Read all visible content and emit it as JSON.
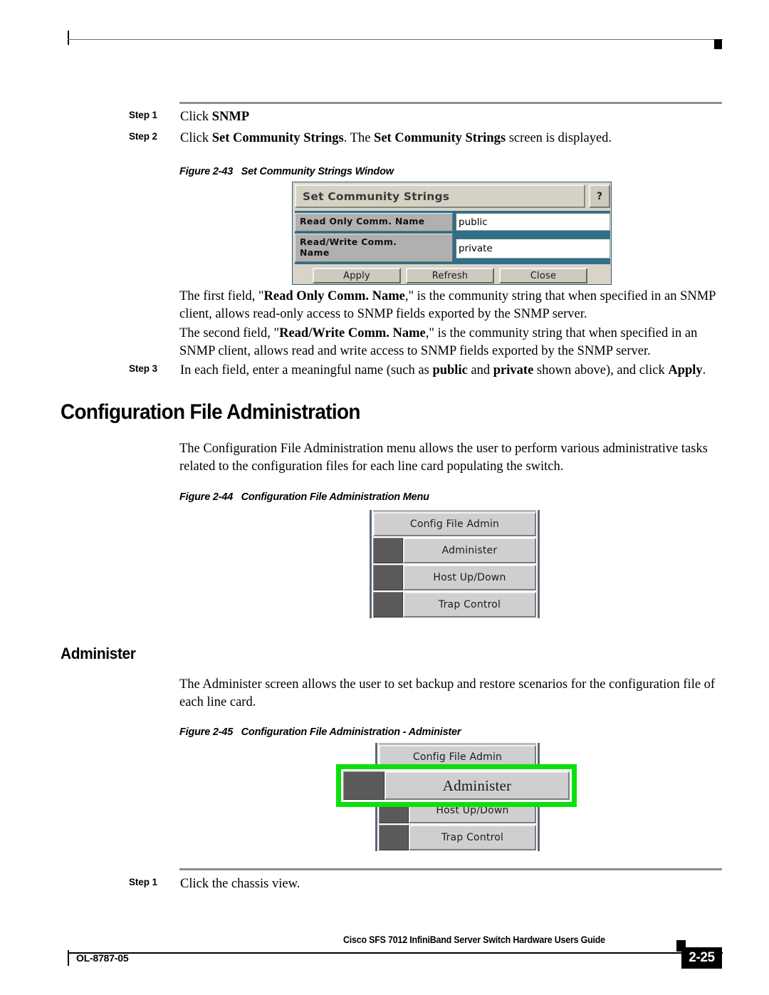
{
  "steps": {
    "step1_label": "Step 1",
    "step1_text_plain": "Click SNMP",
    "step1_bold": "SNMP",
    "step1_prefix": "Click ",
    "step2_label": "Step 2",
    "step3_label": "Step 3",
    "step4_label": "Step 1",
    "step4_text": "Click the chassis view."
  },
  "paragraphs": {
    "p_first_field": "The first field, \"Read Only Comm. Name,\" is the community string that when specified in an SNMP client, allows read-only access to SNMP fields exported by the SNMP server.",
    "p_second_field": "The second field, \"Read/Write Comm. Name,\" is the community string that when specified in an SNMP client, allows read and write access to SNMP fields exported by the SNMP server.",
    "p_config_intro": "The Configuration File Administration menu allows the user to perform various administrative tasks related to the configuration files for each line card populating the switch.",
    "p_administer_intro": "The Administer screen allows the user to set backup and restore scenarios for the configuration file of each line card."
  },
  "headings": {
    "section_config": "Configuration File Administration",
    "section_administer": "Administer"
  },
  "captions": {
    "fig_2_43": "Figure 2-43   Set Community Strings Window",
    "fig_2_44": "Figure 2-44   Configuration File Administration Menu",
    "fig_2_45": "Figure 2-45   Configuration File Administration - Administer"
  },
  "scs_dialog": {
    "title": "Set Community Strings",
    "help_label": "?",
    "rows": [
      {
        "label": "Read Only Comm. Name",
        "value": "public"
      },
      {
        "label": "Read/Write Comm.\nName",
        "value": "private"
      }
    ],
    "row1_label": "Read Only Comm. Name",
    "row1_value": "public",
    "row2_label_line1": "Read/Write Comm.",
    "row2_label_line2": "Name",
    "row2_value": "private",
    "buttons": [
      "Apply",
      "Refresh",
      "Close"
    ],
    "btn_apply": "Apply",
    "btn_refresh": "Refresh",
    "btn_close": "Close",
    "colors": {
      "titlebar": "#d5d1c4",
      "panel": "#2e6f8a",
      "label_cell": "#b0b0b0",
      "field": "#ffffff",
      "button": "#cdcac0"
    }
  },
  "config_menu": {
    "items": [
      "Config File Admin",
      "Administer",
      "Host Up/Down",
      "Trap Control"
    ],
    "item0": "Config File Admin",
    "item1": "Administer",
    "item2": "Host Up/Down",
    "item3": "Trap Control",
    "colors": {
      "button": "#cfcfcf",
      "indent": "#5a5a5a"
    }
  },
  "administer_menu": {
    "items": [
      "Config File Admin",
      "Administer",
      "Host Up/Down",
      "Trap Control"
    ],
    "item0": "Config File Admin",
    "item1": "Administer",
    "item2": "Host Up/Down",
    "item3": "Trap Control",
    "highlight_label": "Administer",
    "highlight_color": "#0BE00B"
  },
  "footer": {
    "guide_title": "Cisco SFS 7012 InfiniBand Server Switch Hardware Users Guide",
    "doc_id": "OL-8787-05",
    "page_number": "2-25"
  }
}
